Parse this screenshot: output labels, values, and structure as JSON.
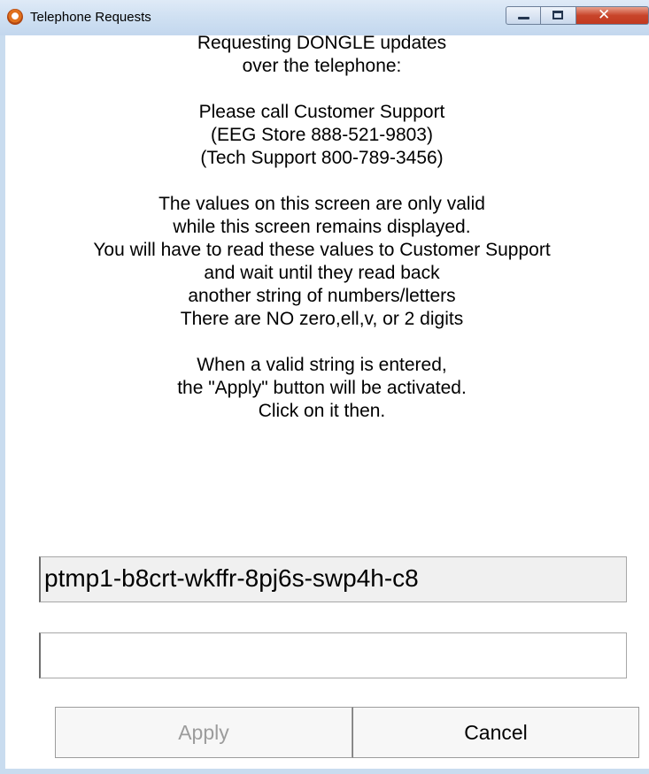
{
  "window": {
    "title": "Telephone Requests",
    "icon": "app-icon",
    "controls": {
      "minimize": "minimize-icon",
      "maximize": "maximize-icon",
      "close": "close-icon"
    }
  },
  "message": {
    "lines": [
      "Requesting DONGLE updates",
      "over the telephone:",
      "",
      "Please call Customer Support",
      "(EEG Store 888-521-9803)",
      "(Tech Support 800-789-3456)",
      "",
      "The values on this screen are only valid",
      "while this screen remains displayed.",
      "You will have to read these values to Customer Support",
      "and wait until they read back",
      "another string of numbers/letters",
      "There are NO zero,ell,v, or 2 digits",
      "",
      "When a valid string is entered,",
      "the \"Apply\" button will be activated.",
      "Click on it then."
    ]
  },
  "request_code": "ptmp1-b8crt-wkffr-8pj6s-swp4h-c8",
  "response_input": {
    "value": "",
    "placeholder": ""
  },
  "buttons": {
    "apply": "Apply",
    "cancel": "Cancel"
  },
  "colors": {
    "frame": "#c9dcef",
    "disabled_text": "#9c9c9c",
    "readonly_bg": "#f0f0f0"
  }
}
